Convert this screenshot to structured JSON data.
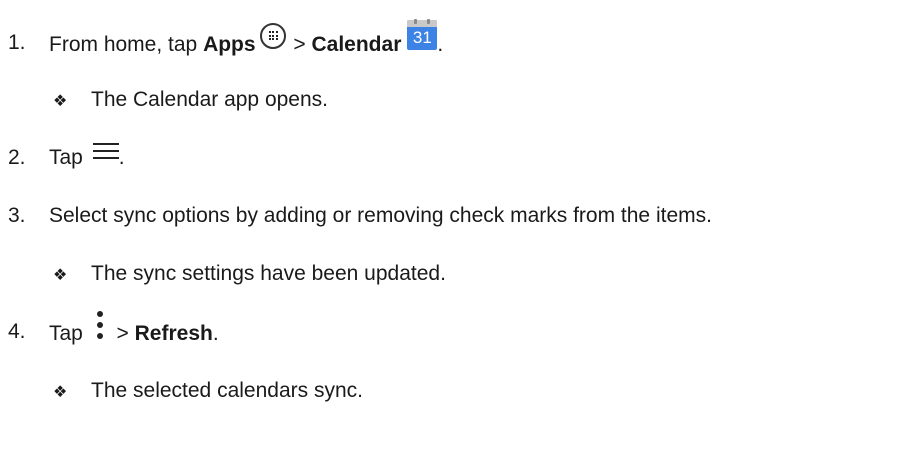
{
  "steps": [
    {
      "number": "1.",
      "parts": {
        "prefix": "From home, tap ",
        "bold1": "Apps",
        "sep": " > ",
        "bold2": "Calendar",
        "suffix": "."
      },
      "result": "The Calendar app opens."
    },
    {
      "number": "2.",
      "parts": {
        "prefix": "Tap ",
        "suffix": "."
      }
    },
    {
      "number": "3.",
      "text": "Select sync options by adding or removing check marks from the items.",
      "result": "The sync settings have been updated."
    },
    {
      "number": "4.",
      "parts": {
        "prefix": "Tap ",
        "sep": " > ",
        "bold": "Refresh",
        "suffix": "."
      },
      "result": "The selected calendars sync."
    }
  ],
  "bullet_symbol": "❖",
  "calendar_icon_date": "31",
  "icons": {
    "apps": "apps-icon",
    "calendar": "calendar-icon",
    "menu": "menu-icon",
    "overflow": "more-options-icon"
  }
}
